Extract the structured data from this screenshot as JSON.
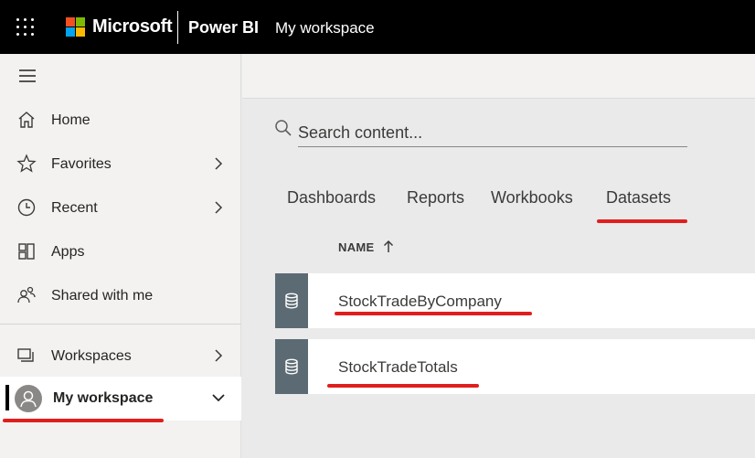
{
  "header": {
    "brand": "Microsoft",
    "product": "Power BI",
    "workspace": "My workspace"
  },
  "sidebar": {
    "items": [
      {
        "label": "Home",
        "icon": "home-icon"
      },
      {
        "label": "Favorites",
        "icon": "star-icon",
        "has_chevron": true
      },
      {
        "label": "Recent",
        "icon": "clock-icon",
        "has_chevron": true
      },
      {
        "label": "Apps",
        "icon": "apps-icon"
      },
      {
        "label": "Shared with me",
        "icon": "shared-icon"
      },
      {
        "label": "Workspaces",
        "icon": "workspaces-icon",
        "has_chevron": true
      }
    ],
    "current_workspace": "My workspace"
  },
  "search": {
    "placeholder": "Search content..."
  },
  "tabs": [
    {
      "label": "Dashboards"
    },
    {
      "label": "Reports"
    },
    {
      "label": "Workbooks"
    },
    {
      "label": "Datasets",
      "selected": true
    }
  ],
  "table": {
    "column_name": "NAME",
    "rows": [
      {
        "name": "StockTradeByCompany",
        "icon": "dataset-icon"
      },
      {
        "name": "StockTradeTotals",
        "icon": "dataset-icon"
      }
    ]
  },
  "colors": {
    "topbar": "#000000",
    "sidebar": "#f3f2f1",
    "annotation_red": "#e01e1e",
    "dataset_tile": "#5c6b73"
  }
}
